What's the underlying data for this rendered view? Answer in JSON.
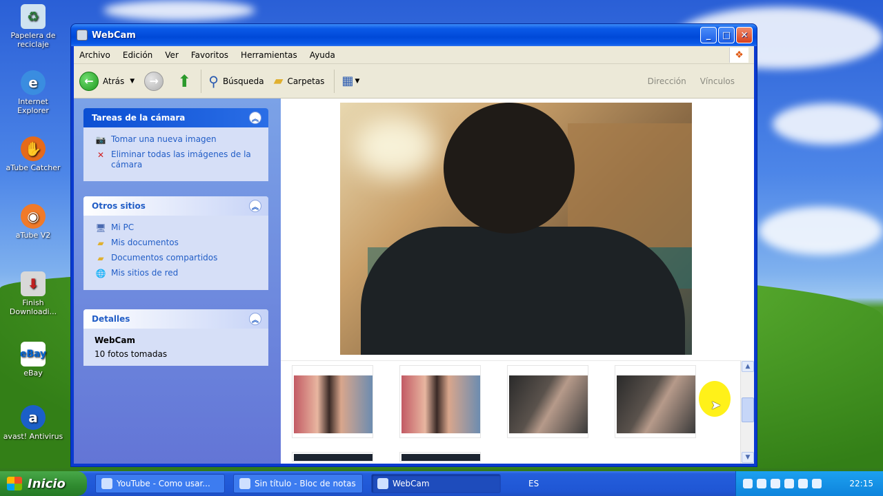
{
  "desktop": {
    "icons": [
      {
        "label": "Papelera de reciclaje",
        "icon": "recycle-bin-icon"
      },
      {
        "label": "Internet Explorer",
        "icon": "internet-explorer-icon"
      },
      {
        "label": "aTube Catcher",
        "icon": "atube-catcher-icon"
      },
      {
        "label": "aTube V2",
        "icon": "atube-icon"
      },
      {
        "label": "Finish Downloadi...",
        "icon": "download-icon"
      },
      {
        "label": "eBay",
        "icon": "ebay-icon"
      },
      {
        "label": "avast! Antivirus",
        "icon": "avast-icon"
      }
    ]
  },
  "window": {
    "title": "WebCam",
    "buttons": {
      "minimize": "_",
      "maximize": "□",
      "close": "✕"
    }
  },
  "menu": [
    "Archivo",
    "Edición",
    "Ver",
    "Favoritos",
    "Herramientas",
    "Ayuda"
  ],
  "toolbar": {
    "back_label": "Atrás",
    "search_label": "Búsqueda",
    "folders_label": "Carpetas",
    "address_label": "Dirección",
    "links_label": "Vínculos"
  },
  "sidebar": {
    "camera_tasks": {
      "title": "Tareas de la cámara",
      "items": [
        "Tomar una nueva imagen",
        "Eliminar todas las imágenes de la cámara"
      ]
    },
    "other_places": {
      "title": "Otros sitios",
      "items": [
        "Mi PC",
        "Mis documentos",
        "Documentos compartidos",
        "Mis sitios de red"
      ]
    },
    "details": {
      "title": "Detalles",
      "name": "WebCam",
      "text": "10 fotos tomadas"
    }
  },
  "taskbar": {
    "start_label": "Inicio",
    "tasks": [
      "YouTube - Como usar...",
      "Sin título - Bloc de notas",
      "WebCam"
    ],
    "language": "ES",
    "clock": "22:15"
  },
  "colors": {
    "titlebar": "#0049d8",
    "link": "#215dc6",
    "sidebar": "#7ba2e7"
  }
}
